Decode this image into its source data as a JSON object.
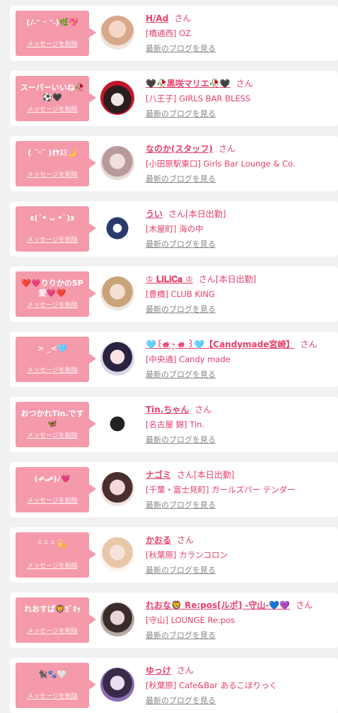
{
  "delete_label": "メッセージを削除",
  "blog_label": "最新のブログを見る",
  "san_label": "さん",
  "accent_color": "#e6406b",
  "bubble_color": "#f59aab",
  "items": [
    {
      "message": "(ﾉ˶ᵔ ᵕ ᵔ˶)🌿💖",
      "name": "H/Ad",
      "status": "",
      "area": "[橋通西] OZ"
    },
    {
      "message": "スーパーいいね🥀⚽🖤",
      "name": "🖤🥀黒咲マリエ🥀🖤",
      "status": "",
      "area": "[八王子] GIRLS BAR BLESS"
    },
    {
      "message": "( ˘ᵕ˘ )ｵﾔｽﾐ🌙",
      "name": "なのか(スタッフ)",
      "status": "",
      "area": "[小田原駅東口] Girls Bar Lounge & Co."
    },
    {
      "message": "ε(´• ᴗ •`)з",
      "name": "うい",
      "status": "[本日出勤]",
      "area": "[木屋町] 海の中"
    },
    {
      "message": "❤️💗りりかのSP愛💗❤️",
      "name": "♔ 𝐋𝐢𝐋𝐢𝐂𝐚 ♔",
      "status": "[本日出勤]",
      "area": "[豊橋] CLUB KING"
    },
    {
      "message": "> _<🩵",
      "name": "🩵꒰ɞ̴̶̷ ·̮ ɞ̴̶̷ ꒱🩵【Candymade宮崎】",
      "status": "",
      "area": "[中央通] Candy made"
    },
    {
      "message": "おつかれTin.です🦋",
      "name": "Tin.ちゃん",
      "status": "",
      "area": "[名古屋 錦] Tin."
    },
    {
      "message": "( ᵔ̴̶̷ᴗᵔ̴̶̷)ﾉ💗",
      "name": "ナゴミ",
      "status": "[本日出勤]",
      "area": "[千葉・富士見町] ガールズバー テンダー"
    },
    {
      "message": "ᵕ̈ ᵕ̈ ᵕ̈ 💫",
      "name": "かおる",
      "status": "",
      "area": "[秋葉原] カランコロン"
    },
    {
      "message": "れおすぱ🦁ｶﾞｵｯ",
      "name": "れおな🦁 Re:pos[ルポ] -守山-💙💜",
      "status": "",
      "area": "[守山] LOUNGE Re:pos"
    },
    {
      "message": "🐈‍⬛🐾🤍",
      "name": "ゆっけ",
      "status": "",
      "area": "[秋葉原] Cafe&Bar あるこほりっく"
    }
  ]
}
